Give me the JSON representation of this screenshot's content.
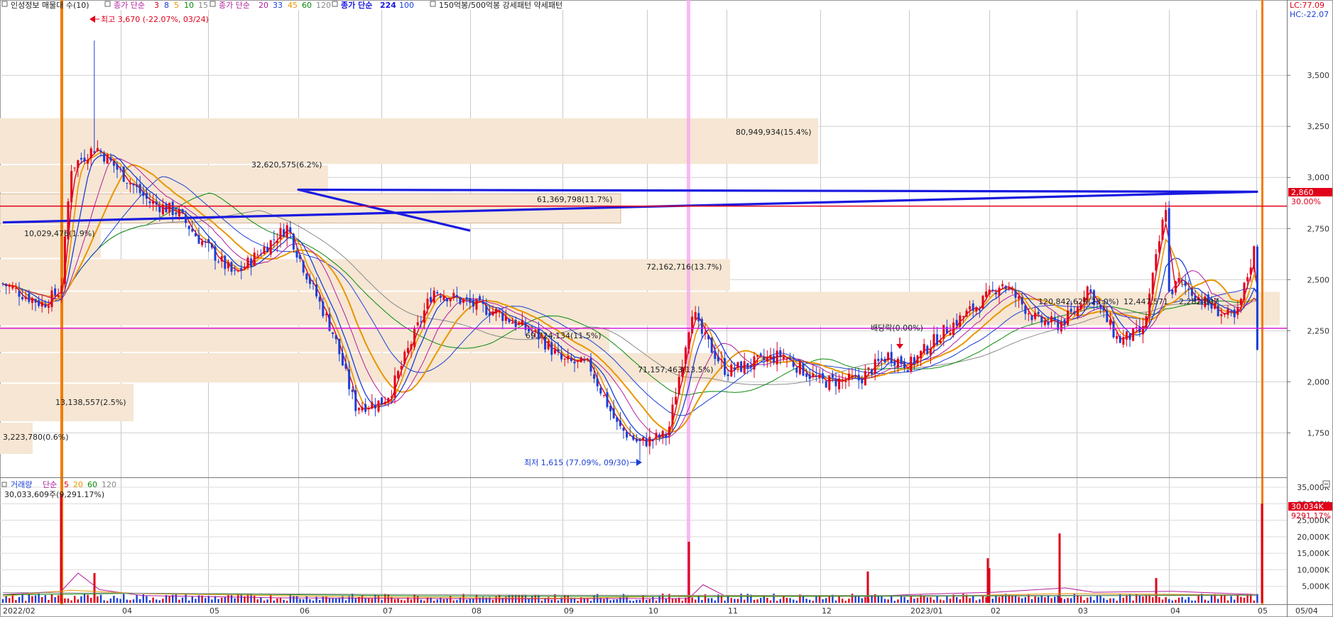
{
  "legend": {
    "stock_name": "인성정보 매물대 수(10)",
    "ma_group1_title": "종가 단순",
    "ma_group1_periods": [
      "3",
      "8",
      "5",
      "10",
      "15"
    ],
    "ma_group2_title": "종가 단순",
    "ma_group2_periods": [
      "20",
      "33",
      "45",
      "60",
      "120"
    ],
    "ma_group3_title": "종가 단순",
    "ma_group3_periods": [
      "224",
      "100"
    ],
    "pattern_text": "150억봉/500억봉 강세패턴  약세패턴",
    "volume_title": "거래량",
    "volume_ma_title": "단순",
    "volume_ma_periods": [
      "5",
      "20",
      "60",
      "120"
    ],
    "volume_value": "30,033,609주(9,291.17%)"
  },
  "colors": {
    "up": "#e0001a",
    "down": "#1b3fd6",
    "ma224": "#1a1adf",
    "h_red": "#e3001b",
    "h_magenta": "#d81bd8",
    "v_orange": "#f07d00",
    "v_pink": "#f7a8f0",
    "profile": "#f6e6d3"
  },
  "annotations": {
    "high": "최고 3,670 (-22.07%, 03/24)",
    "low": "최저 1,615 (77.09%, 09/30)",
    "dividend": "배당락(0.00%)",
    "lc": "LC:77.09",
    "hc": "HC:-22.07",
    "current_price": "2,860",
    "current_pct": "30.00%",
    "vol_current": "30,034K",
    "vol_pct": "9291.17%"
  },
  "volume_profile_labels": [
    "80,949,934(15.4%)",
    "32,620,575(6.2%)",
    "61,369,798(11.7%)",
    "10,029,476(1.9%)",
    "72,162,716(13.7%)",
    "120,842,629(23.0%)",
    "12,447,571",
    "2,282,007",
    "69,724,134(11.5%)",
    "71,157,463(13.5%)",
    "13,138,557(2.5%)",
    "3,223,780(0.6%)"
  ],
  "chart_data": [
    {
      "type": "candlestick",
      "title": "인성정보 매물대 수(10)",
      "x_ticks": [
        "2022/02",
        "04",
        "05",
        "06",
        "07",
        "08",
        "09",
        "10",
        "11",
        "12",
        "2023/01",
        "02",
        "03",
        "04",
        "05",
        "05/04"
      ],
      "y_ticks": [
        "3,500",
        "3,250",
        "3,000",
        "2,750",
        "2,500",
        "2,250",
        "2,000",
        "1,750"
      ],
      "ylim": [
        1550,
        3820
      ],
      "key_points": [
        {
          "date": "2022/02",
          "close": 2480
        },
        {
          "date": "03/10",
          "close": 2450
        },
        {
          "date": "03/24",
          "high": 3670,
          "close": 3150
        },
        {
          "date": "04",
          "close": 2950
        },
        {
          "date": "05",
          "close": 2700
        },
        {
          "date": "06",
          "close": 2620
        },
        {
          "date": "07",
          "close": 1900
        },
        {
          "date": "08",
          "close": 2380
        },
        {
          "date": "09",
          "close": 2100
        },
        {
          "date": "09/30",
          "low": 1615,
          "close": 1700
        },
        {
          "date": "10/20",
          "close": 2360
        },
        {
          "date": "11",
          "close": 2050
        },
        {
          "date": "12",
          "close": 2000
        },
        {
          "date": "2023/01",
          "close": 2080
        },
        {
          "date": "02",
          "close": 2420
        },
        {
          "date": "03",
          "close": 2350
        },
        {
          "date": "04",
          "close": 2430
        },
        {
          "date": "05",
          "close": 2180
        }
      ],
      "ma224": [
        {
          "date": "2022/02",
          "value": 2780
        },
        {
          "date": "05",
          "value": 2930
        },
        {
          "date": "06",
          "value": 2940
        },
        {
          "date": "08",
          "value": 2740
        },
        {
          "date": "10",
          "value": 2570
        },
        {
          "date": "12",
          "value": 2380
        },
        {
          "date": "2023/01",
          "value": 2340
        },
        {
          "date": "03",
          "value": 2230
        },
        {
          "date": "05",
          "value": 2170
        }
      ],
      "h_lines": [
        2860,
        2262
      ]
    },
    {
      "type": "bar",
      "title": "거래량",
      "y_ticks": [
        "35,000K",
        "30,000K",
        "25,000K",
        "20,000K",
        "15,000K",
        "10,000K",
        "5,000K"
      ],
      "ylim": [
        0,
        36500
      ],
      "spikes": [
        {
          "date": "03/10",
          "value": 33000
        },
        {
          "date": "03/24",
          "value": 9000
        },
        {
          "date": "10/20",
          "value": 18500
        },
        {
          "date": "12/29",
          "value": 9500
        },
        {
          "date": "02/15",
          "value": 10500
        },
        {
          "date": "03/02",
          "value": 21000
        },
        {
          "date": "03/22",
          "value": 13500
        },
        {
          "date": "04/10",
          "value": 7500
        },
        {
          "date": "05/04",
          "value": 30034
        }
      ]
    }
  ]
}
